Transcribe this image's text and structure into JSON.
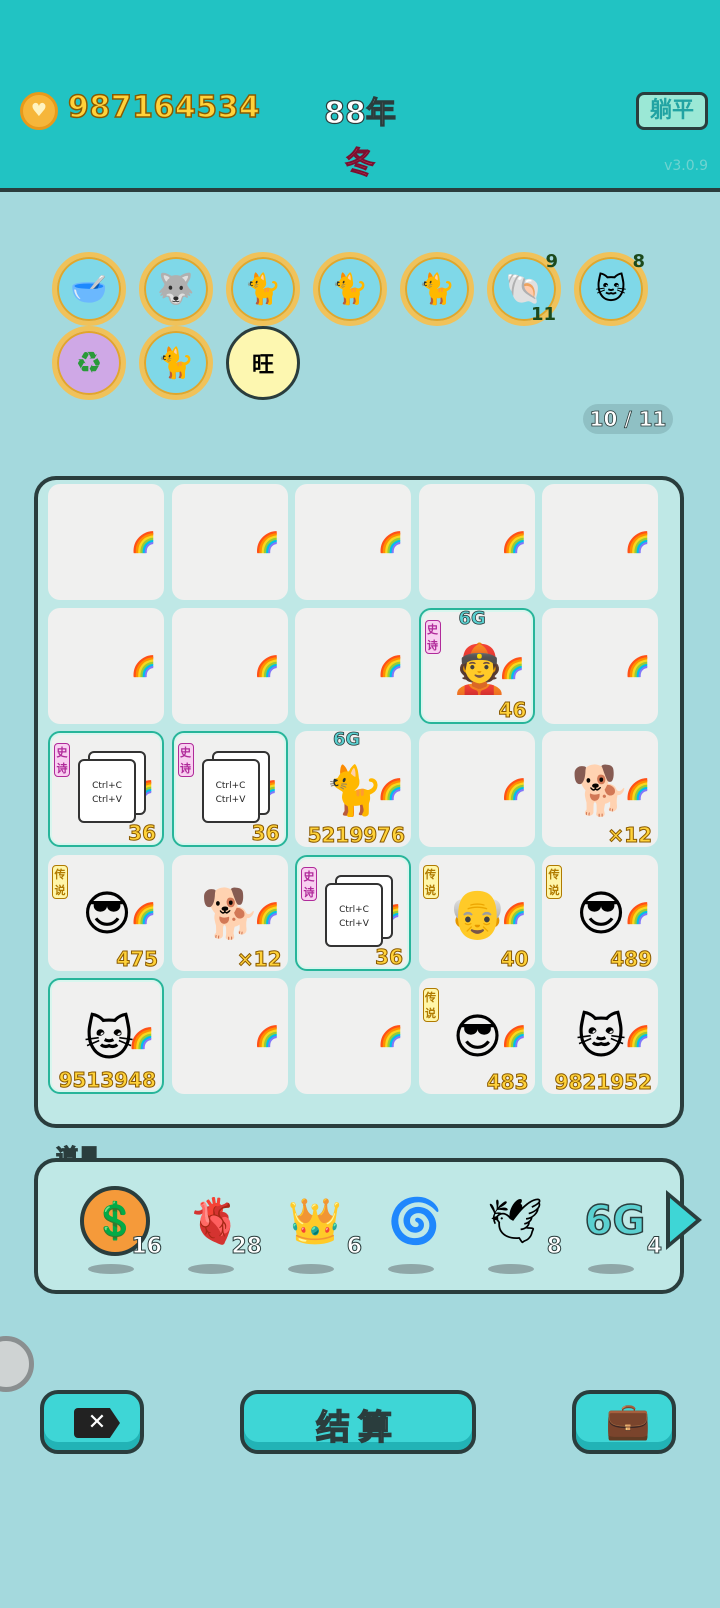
{
  "header": {
    "money": "987164534",
    "year": "88年",
    "season": "冬",
    "flat_button": "躺平",
    "version": "v3.0.9"
  },
  "badges": [
    {
      "name": "food-bowl-icon",
      "glyph": "🥣"
    },
    {
      "name": "husky-sunglasses-icon",
      "glyph": "🐺"
    },
    {
      "name": "cat-pair-coin-icon",
      "glyph": "🐈"
    },
    {
      "name": "cat-pair-coin-icon",
      "glyph": "🐈"
    },
    {
      "name": "cat-pair-coin-icon",
      "glyph": "🐈"
    },
    {
      "name": "shell-icon",
      "glyph": "🐚",
      "top": "9",
      "bottom": "11"
    },
    {
      "name": "cat-coin-icon",
      "glyph": "🐱",
      "top": "8"
    },
    {
      "name": "recycle-icon",
      "glyph": "♻"
    },
    {
      "name": "cat-pair-coin-icon",
      "glyph": "🐈"
    },
    {
      "name": "wang-icon",
      "glyph": "旺"
    }
  ],
  "page_counter": "10 / 11",
  "board": {
    "cells": [
      {},
      {},
      {},
      {},
      {},
      {},
      {},
      {},
      {
        "char": "👲",
        "tag": "史诗",
        "tagtype": "epic",
        "g6": "6G",
        "value": "46",
        "rare": true
      },
      {},
      {
        "copy": [
          "Ctrl+C",
          "Ctrl+V"
        ],
        "tag": "史诗",
        "tagtype": "epic",
        "value": "36",
        "rare": true
      },
      {
        "copy": [
          "Ctrl+C",
          "Ctrl+V"
        ],
        "tag": "史诗",
        "tagtype": "epic",
        "value": "36",
        "rare": true
      },
      {
        "char": "🐈",
        "g6": "6G",
        "value": "5219976"
      },
      {},
      {
        "char": "🐕",
        "value": "×12"
      },
      {
        "char": "😎",
        "tag": "传说",
        "tagtype": "legend",
        "value": "475"
      },
      {
        "char": "🐕",
        "value": "×12"
      },
      {
        "copy": [
          "Ctrl+C",
          "Ctrl+V"
        ],
        "tag": "史诗",
        "tagtype": "epic",
        "value": "36",
        "rare": true
      },
      {
        "char": "👴",
        "tag": "传说",
        "tagtype": "legend",
        "value": "40"
      },
      {
        "char": "😎",
        "tag": "传说",
        "tagtype": "legend",
        "value": "489"
      },
      {
        "char": "🐱",
        "value": "9513948",
        "rare": true
      },
      {},
      {},
      {
        "char": "😎",
        "tag": "传说",
        "tagtype": "legend",
        "value": "483"
      },
      {
        "char": "🐱",
        "value": "9821952"
      }
    ],
    "rainbow_glyph": "🌈"
  },
  "tools": {
    "title": "道具",
    "items": [
      {
        "name": "dollar-coin-icon",
        "glyph": "💲",
        "count": "16"
      },
      {
        "name": "liver-icon",
        "glyph": "🫀",
        "count": "28"
      },
      {
        "name": "crown-icon",
        "glyph": "👑",
        "count": "6"
      },
      {
        "name": "black-hole-icon",
        "glyph": "🌀",
        "count": ""
      },
      {
        "name": "dove-icon",
        "glyph": "🕊",
        "count": "8"
      },
      {
        "name": "6g-icon",
        "glyph": "6G",
        "count": "4"
      }
    ]
  },
  "buttons": {
    "settle": "结算"
  }
}
